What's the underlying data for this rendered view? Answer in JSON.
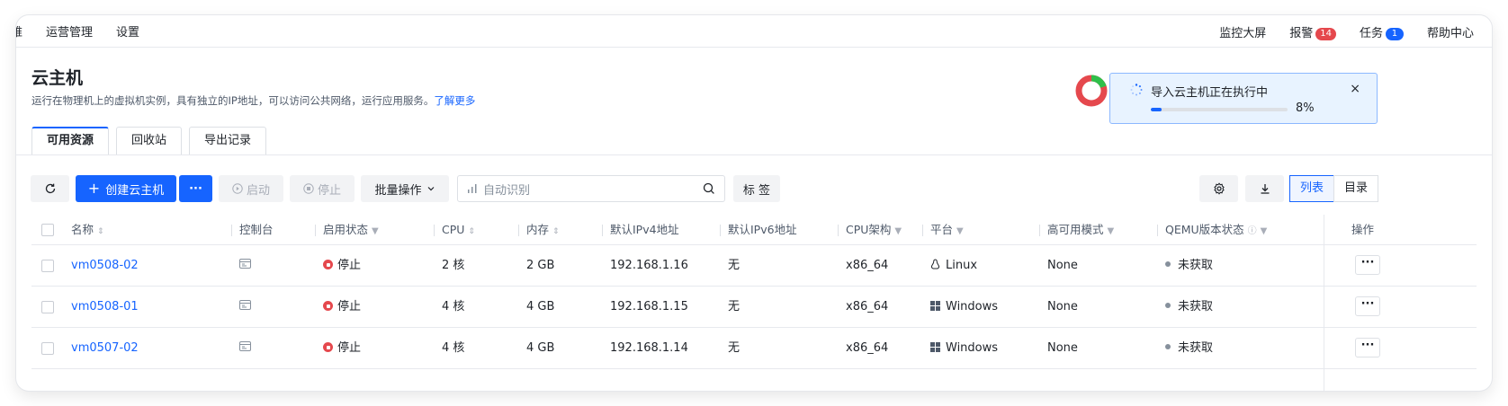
{
  "topnav": {
    "left_items": [
      "维",
      "运营管理",
      "设置"
    ],
    "right_items": {
      "monitor": "监控大屏",
      "alarm": "报警",
      "alarm_count": "14",
      "task": "任务",
      "task_count": "1",
      "help": "帮助中心"
    }
  },
  "header": {
    "title": "云主机",
    "description": "运行在物理机上的虚拟机实例，具有独立的IP地址，可以访问公共网络，运行应用服务。",
    "learn_more": "了解更多"
  },
  "tabs": [
    "可用资源",
    "回收站",
    "导出记录"
  ],
  "active_tab": 0,
  "toolbar": {
    "create_label": "创建云主机",
    "more_label": "···",
    "start_label": "启动",
    "stop_label": "停止",
    "batch_label": "批量操作",
    "search_placeholder": "自动识别",
    "tag_label": "标 签",
    "view_list": "列表",
    "view_dir": "目录"
  },
  "table": {
    "columns": [
      "名称",
      "控制台",
      "启用状态",
      "CPU",
      "内存",
      "默认IPv4地址",
      "默认IPv6地址",
      "CPU架构",
      "平台",
      "高可用模式",
      "QEMU版本状态",
      "操作"
    ],
    "rows": [
      {
        "name": "vm0508-02",
        "status": "停止",
        "cpu": "2 核",
        "memory": "2 GB",
        "ipv4": "192.168.1.16",
        "ipv6": "无",
        "arch": "x86_64",
        "platform": "Linux",
        "platform_icon": "linux-icon",
        "ha": "None",
        "qemu": "未获取",
        "more": "···"
      },
      {
        "name": "vm0508-01",
        "status": "停止",
        "cpu": "4 核",
        "memory": "4 GB",
        "ipv4": "192.168.1.15",
        "ipv6": "无",
        "arch": "x86_64",
        "platform": "Windows",
        "platform_icon": "windows-icon",
        "ha": "None",
        "qemu": "未获取",
        "more": "···"
      },
      {
        "name": "vm0507-02",
        "status": "停止",
        "cpu": "4 核",
        "memory": "4 GB",
        "ipv4": "192.168.1.14",
        "ipv6": "无",
        "arch": "x86_64",
        "platform": "Windows",
        "platform_icon": "windows-icon",
        "ha": "None",
        "qemu": "未获取",
        "more": "···"
      }
    ]
  },
  "toast": {
    "title": "导入云主机正在执行中",
    "progress": 8,
    "progress_label": "8%",
    "close": "×"
  },
  "colors": {
    "primary": "#1664ff",
    "danger": "#e5484d",
    "success": "#2fbf4a",
    "toast_bg": "#e8f3ff"
  }
}
